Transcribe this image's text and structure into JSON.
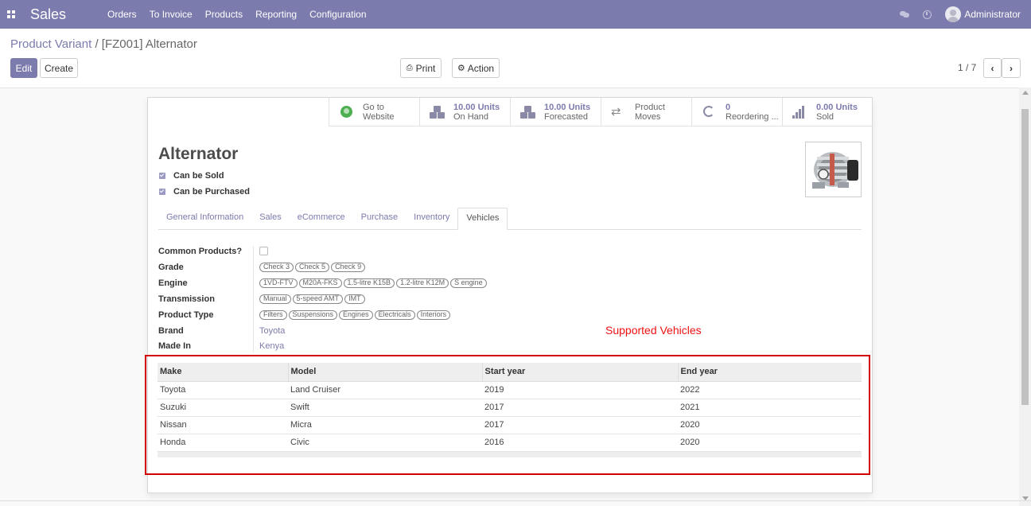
{
  "navbar": {
    "brand": "Sales",
    "menu": [
      "Orders",
      "To Invoice",
      "Products",
      "Reporting",
      "Configuration"
    ],
    "user": "Administrator",
    "colors": {
      "navbar": "#7c7bad",
      "accent": "#7c7bad"
    }
  },
  "breadcrumb": {
    "parent": "Product Variant",
    "separator": "/",
    "current": "[FZ001] Alternator"
  },
  "actions": {
    "edit": "Edit",
    "create": "Create",
    "print": "Print",
    "action": "Action"
  },
  "pager": {
    "text": "1 / 7"
  },
  "smart_buttons": [
    {
      "value": "Go to",
      "label": "Website",
      "icon": "globe-icon"
    },
    {
      "value": "10.00 Units",
      "label": "On Hand",
      "icon": "cubes-icon"
    },
    {
      "value": "10.00 Units",
      "label": "Forecasted",
      "icon": "cubes-icon"
    },
    {
      "value": "",
      "label": "Product Moves",
      "icon": "exchange-icon"
    },
    {
      "value": "0",
      "label": "Reordering ...",
      "icon": "refresh-icon"
    },
    {
      "value": "0.00 Units",
      "label": "Sold",
      "icon": "signal-icon"
    }
  ],
  "product": {
    "name": "Alternator",
    "can_be_sold": "Can be Sold",
    "can_be_purchased": "Can be Purchased"
  },
  "tabs": [
    "General Information",
    "Sales",
    "eCommerce",
    "Purchase",
    "Inventory",
    "Vehicles"
  ],
  "active_tab": "Vehicles",
  "fields": {
    "common_products": {
      "label": "Common Products?"
    },
    "grade": {
      "label": "Grade",
      "tags": [
        "Check 3",
        "Check 5",
        "Check 9"
      ]
    },
    "engine": {
      "label": "Engine",
      "tags": [
        "1VD-FTV",
        "M20A-FKS",
        "1.5-litre K15B",
        "1.2-litre K12M",
        "S engine"
      ]
    },
    "transmission": {
      "label": "Transmission",
      "tags": [
        "Manual",
        "5-speed AMT",
        "IMT"
      ]
    },
    "product_type": {
      "label": "Product Type",
      "tags": [
        "Filters",
        "Suspensions",
        "Engines",
        "Electricals",
        "Interiors"
      ]
    },
    "brand": {
      "label": "Brand",
      "value": "Toyota"
    },
    "made_in": {
      "label": "Made In",
      "value": "Kenya"
    }
  },
  "annotation": "Supported Vehicles",
  "vehicles_table": {
    "columns": [
      "Make",
      "Model",
      "Start year",
      "End year"
    ],
    "rows": [
      [
        "Toyota",
        "Land Cruiser",
        "2019",
        "2022"
      ],
      [
        "Suzuki",
        "Swift",
        "2017",
        "2021"
      ],
      [
        "Nissan",
        "Micra",
        "2017",
        "2020"
      ],
      [
        "Honda",
        "Civic",
        "2016",
        "2020"
      ]
    ]
  }
}
